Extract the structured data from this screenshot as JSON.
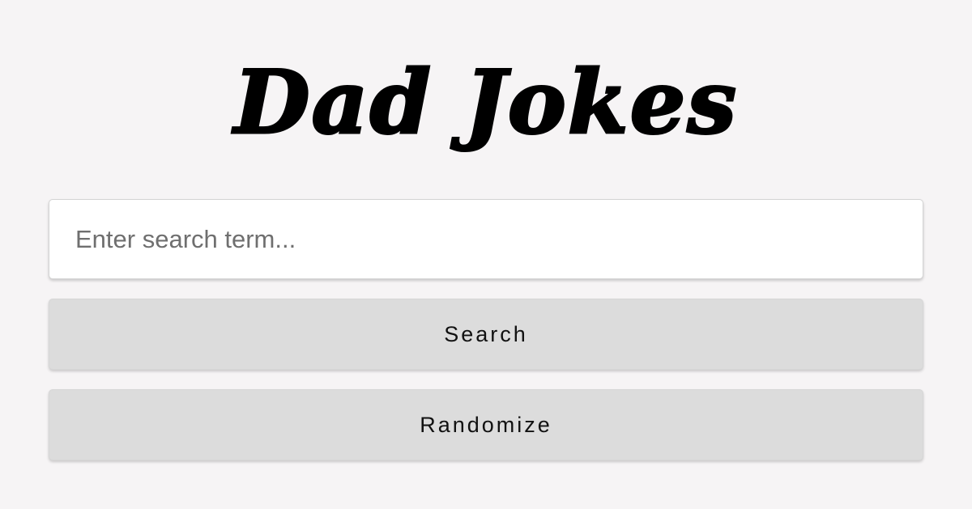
{
  "header": {
    "title": "Dad Jokes"
  },
  "search": {
    "value": "",
    "placeholder": "Enter search term..."
  },
  "actions": {
    "search_label": "Search",
    "randomize_label": "Randomize"
  },
  "colors": {
    "background": "#f6f4f5",
    "input_background": "#ffffff",
    "button_background": "#dcdcdc",
    "title_color": "#000000"
  }
}
